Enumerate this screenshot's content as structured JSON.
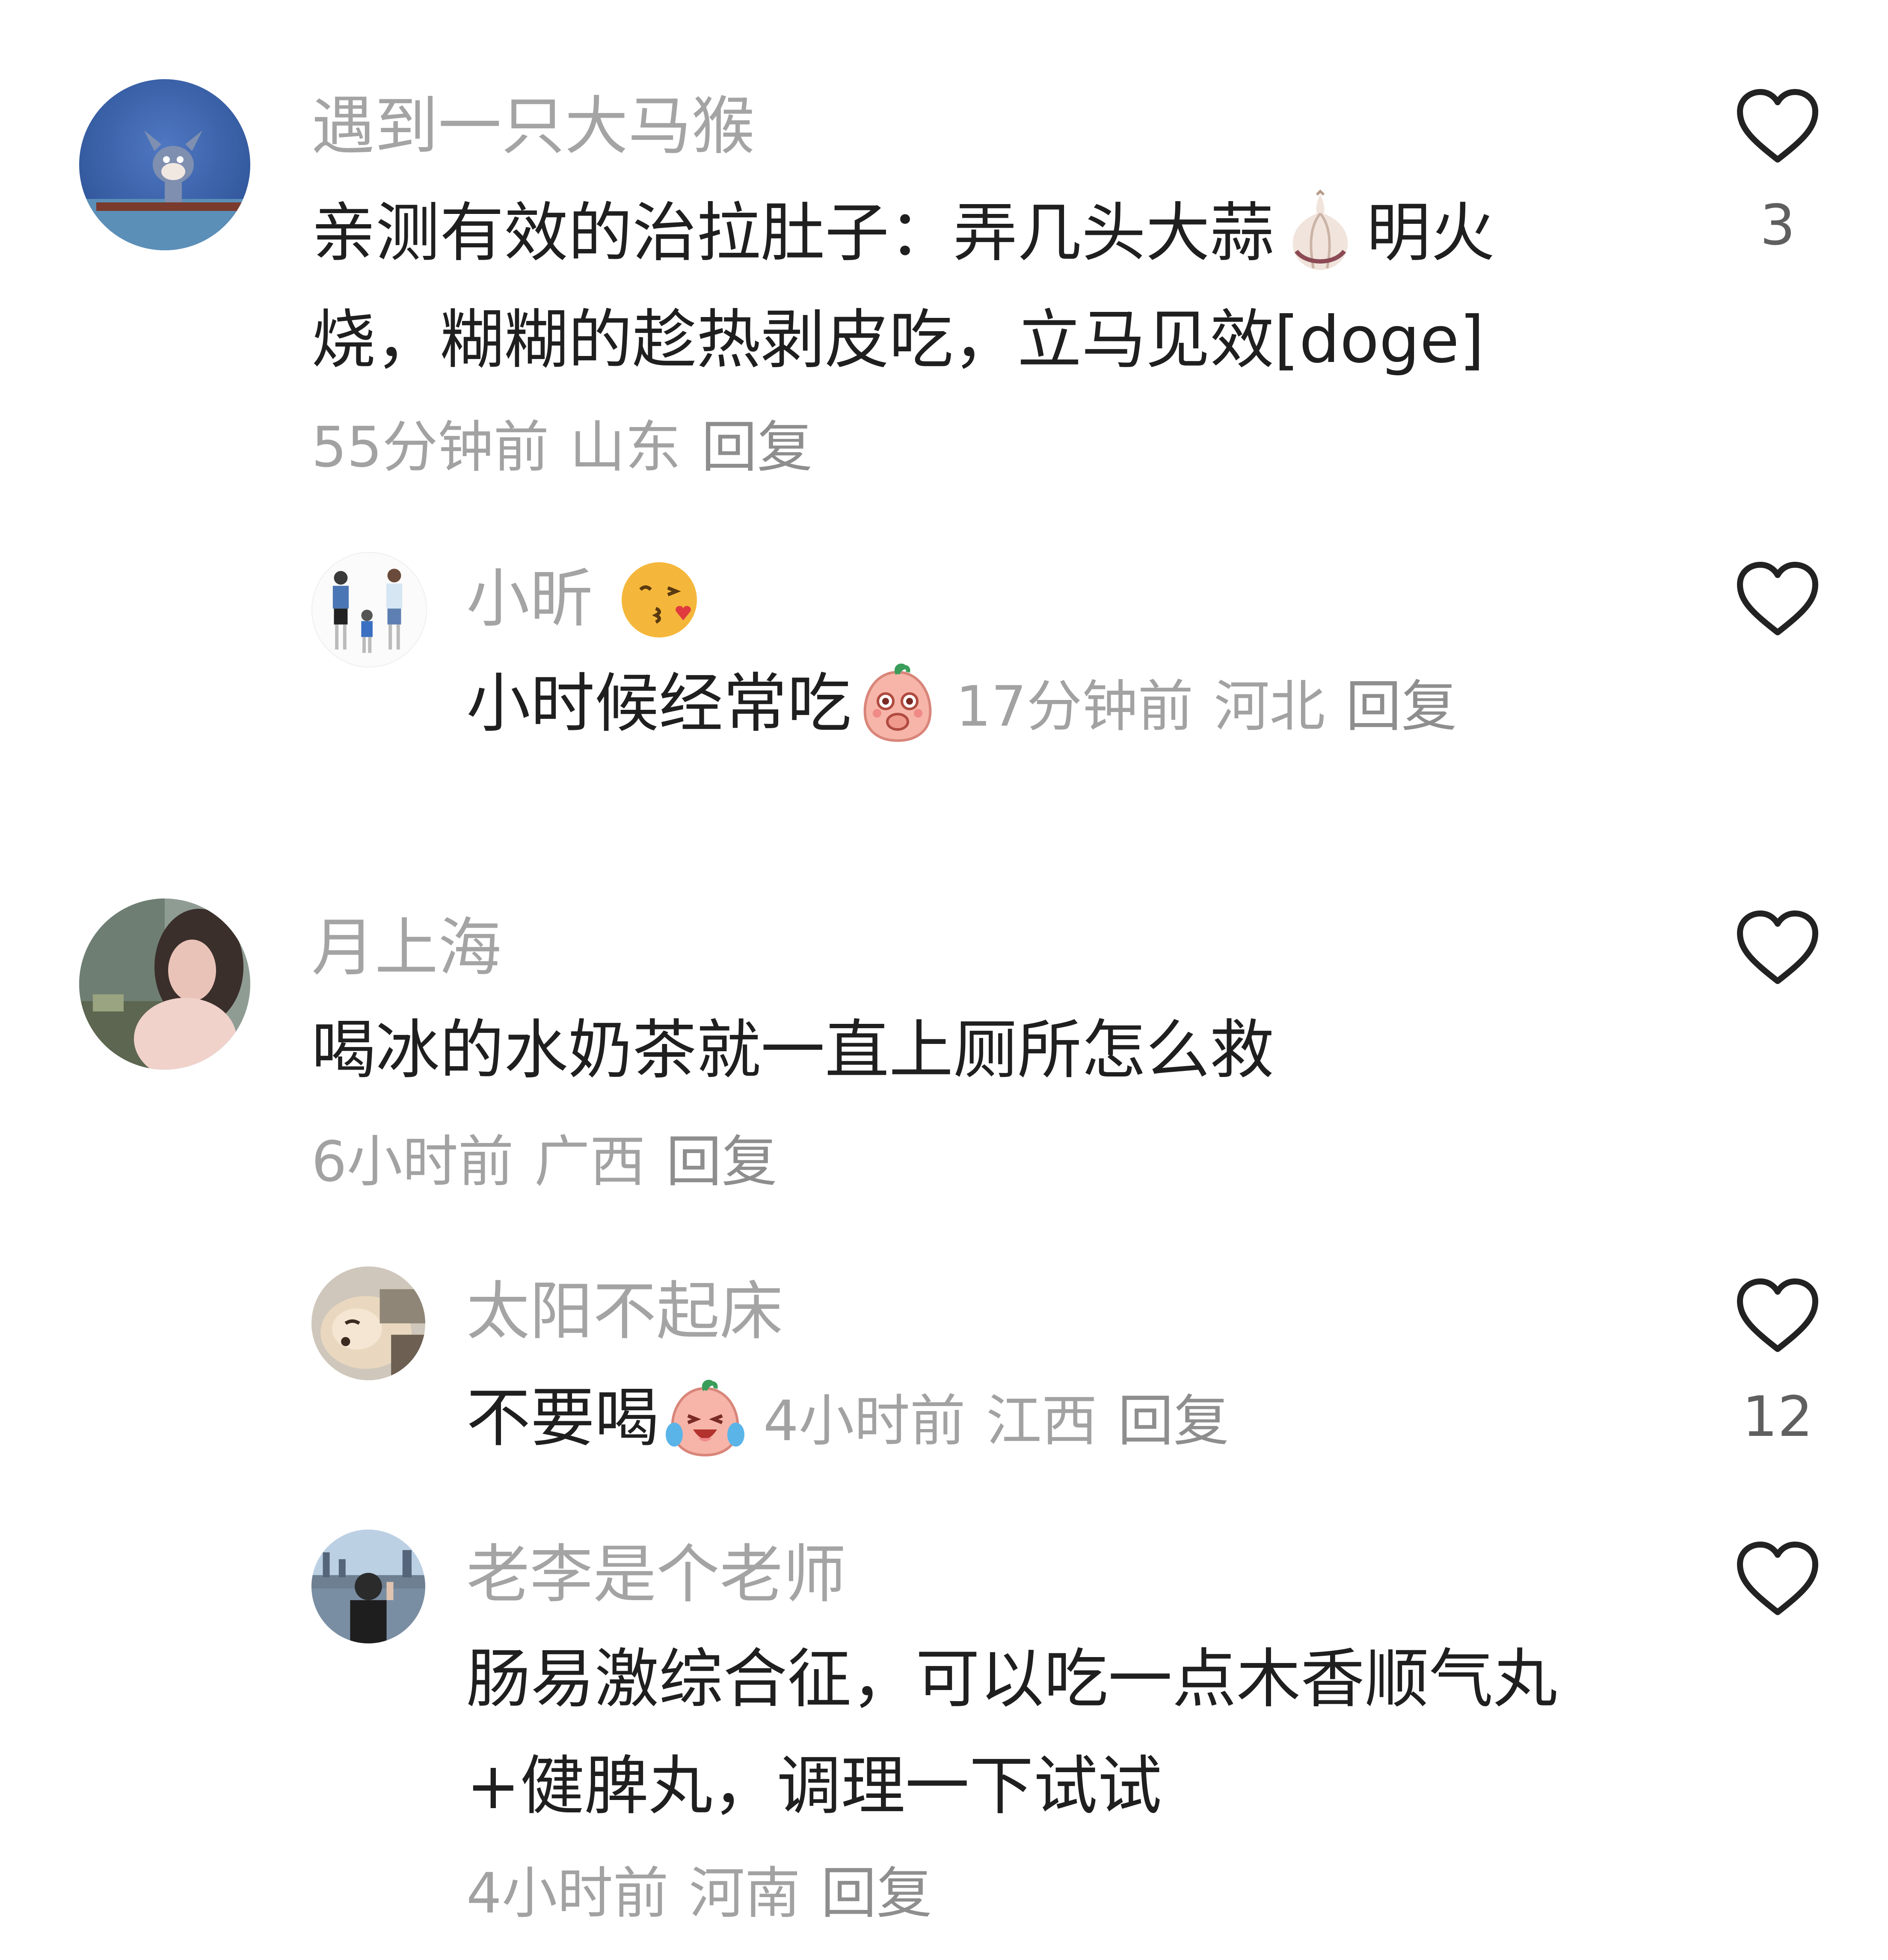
{
  "comments": [
    {
      "username": "遇到一只大马猴",
      "text_line1": "亲测有效的治拉肚子：弄几头大蒜",
      "text_line1_after": "明火",
      "text_line2": "烧，糊糊的趁热剥皮吃，立马见效[doge]",
      "time": "55分钟前",
      "location": "山东",
      "reply": "回复",
      "likes": "3",
      "replies": [
        {
          "username": "小昕",
          "text": "小时候经常吃",
          "time": "17分钟前",
          "location": "河北",
          "reply": "回复"
        }
      ]
    },
    {
      "username": "月上海",
      "text": "喝冰的水奶茶就一直上厕所怎么救",
      "time": "6小时前",
      "location": "广西",
      "reply": "回复",
      "replies": [
        {
          "username": "太阳不起床",
          "text": "不要喝",
          "time": "4小时前",
          "location": "江西",
          "reply": "回复",
          "likes": "12"
        },
        {
          "username": "老李是个老师",
          "text_line1": "肠易激综合征，可以吃一点木香顺气丸",
          "text_line2": "+健脾丸，调理一下试试",
          "time": "4小时前",
          "location": "河南",
          "reply": "回复"
        }
      ]
    }
  ],
  "colors": {
    "meta": "#a2a2a2",
    "username": "#a4a4a4",
    "heart_stroke": "#222222"
  }
}
